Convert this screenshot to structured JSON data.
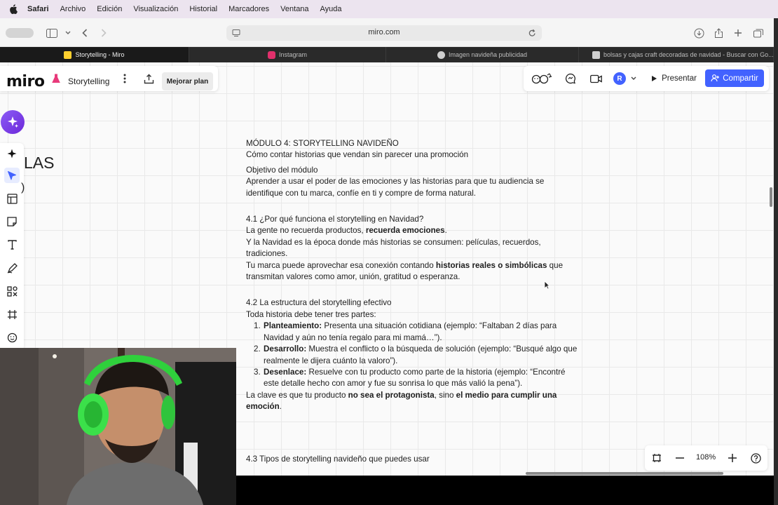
{
  "menubar": {
    "app": "Safari",
    "items": [
      "Archivo",
      "Edición",
      "Visualización",
      "Historial",
      "Marcadores",
      "Ventana",
      "Ayuda"
    ]
  },
  "browser": {
    "url": "miro.com",
    "tabs": [
      {
        "label": "Storytelling - Miro",
        "icon": "miro-favicon",
        "color": "#ffd02f",
        "active": true
      },
      {
        "label": "Instagram",
        "icon": "instagram-favicon",
        "color": "#e1306c",
        "active": false
      },
      {
        "label": "Imagen navideña publicidad",
        "icon": "chatgpt-favicon",
        "color": "#cfcfcf",
        "active": false
      },
      {
        "label": "bolsas y cajas craft decoradas de navidad - Buscar con Go...",
        "icon": "google-favicon",
        "color": "#cfcfcf",
        "active": false
      }
    ]
  },
  "miro": {
    "logo": "miro",
    "board_name": "Storytelling",
    "upgrade_label": "Mejorar plan",
    "present_label": "Presentar",
    "share_label": "Compartir",
    "avatar_initial": "R",
    "zoom": "108%",
    "accent": "#4262ff"
  },
  "canvas": {
    "fragment_1": "LAS",
    "fragment_2": ")"
  },
  "document": {
    "title": "MÓDULO 4: STORYTELLING NAVIDEÑO",
    "subtitle": "Cómo contar historias que vendan sin parecer una promoción",
    "objective_heading": "Objetivo del módulo",
    "objective_l1": "Aprender a usar el poder de las emociones y las historias para que tu audiencia se",
    "objective_l2": "identifique con tu marca, confíe en ti y compre de forma natural.",
    "s41_heading": "4.1 ¿Por qué funciona el storytelling en Navidad?",
    "s41_l1_a": "La gente no recuerda productos, ",
    "s41_l1_b": "recuerda emociones",
    "s41_l1_c": ".",
    "s41_l2": "Y la Navidad es la época donde más historias se consumen: películas, recuerdos,",
    "s41_l3": "tradiciones.",
    "s41_l4_a": " Tu marca puede aprovechar esa conexión contando ",
    "s41_l4_b": "historias reales o simbólicas",
    "s41_l4_c": " que",
    "s41_l5": "transmitan valores como amor, unión, gratitud o esperanza.",
    "s42_heading": "4.2 La estructura del storytelling efectivo",
    "s42_intro": "Toda historia debe tener tres partes:",
    "s42_items": [
      {
        "num": "1.",
        "term": "Planteamiento:",
        "l1": " Presenta una situación cotidiana (ejemplo: “Faltaban 2 días para",
        "l2": "Navidad y aún no tenía regalo para mi mamá…”)."
      },
      {
        "num": "2.",
        "term": "Desarrollo:",
        "l1": " Muestra el conflicto o la búsqueda de solución (ejemplo: “Busqué algo que",
        "l2": "realmente le dijera cuánto la valoro”)."
      },
      {
        "num": "3.",
        "term": "Desenlace:",
        "l1": " Resuelve con tu producto como parte de la historia (ejemplo: “Encontré",
        "l2": "este detalle hecho con amor y fue su sonrisa lo que más valió la pena”)."
      }
    ],
    "s42_key_a": " La clave es que tu producto ",
    "s42_key_b": "no sea el protagonista",
    "s42_key_c": ", sino ",
    "s42_key_d": "el medio para cumplir una",
    "s42_key_e": "emoción",
    "s42_key_f": ".",
    "s43_heading": "4.3 Tipos de storytelling navideño que puedes usar"
  }
}
